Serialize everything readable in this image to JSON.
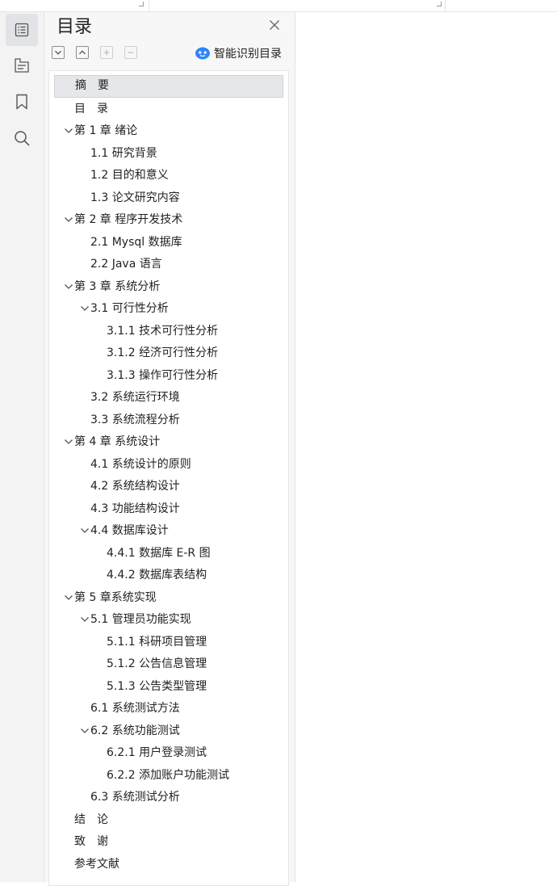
{
  "panel": {
    "title": "目录",
    "smart_label": "智能识别目录"
  },
  "colors": {
    "rail_bg": "#f3f3f3",
    "panel_bg": "#f7f7f7",
    "selected_bg": "#e6e7ea",
    "smart_icon": "#2f86f6"
  },
  "icons": {
    "rail": [
      "toc-icon",
      "outline-icon",
      "bookmark-icon",
      "search-icon"
    ],
    "toolbar": [
      "collapse-all-icon",
      "expand-all-icon",
      "add-icon",
      "remove-icon"
    ]
  },
  "toc": [
    {
      "label": "摘　要",
      "level": 0,
      "expanded": null,
      "selected": true
    },
    {
      "label": "目　录",
      "level": 0,
      "expanded": null
    },
    {
      "label": "第 1 章  绪论",
      "level": 0,
      "expanded": true
    },
    {
      "label": "1.1  研究背景",
      "level": 1,
      "expanded": null
    },
    {
      "label": "1.2 目的和意义",
      "level": 1,
      "expanded": null
    },
    {
      "label": "1.3  论文研究内容",
      "level": 1,
      "expanded": null
    },
    {
      "label": "第 2 章  程序开发技术",
      "level": 0,
      "expanded": true
    },
    {
      "label": "2.1 Mysql 数据库",
      "level": 1,
      "expanded": null
    },
    {
      "label": "2.2 Java 语言",
      "level": 1,
      "expanded": null
    },
    {
      "label": "第 3 章  系统分析",
      "level": 0,
      "expanded": true
    },
    {
      "label": "3.1 可行性分析",
      "level": 1,
      "expanded": true
    },
    {
      "label": "3.1.1 技术可行性分析",
      "level": 2,
      "expanded": null
    },
    {
      "label": "3.1.2 经济可行性分析",
      "level": 2,
      "expanded": null
    },
    {
      "label": "3.1.3 操作可行性分析",
      "level": 2,
      "expanded": null
    },
    {
      "label": "3.2 系统运行环境",
      "level": 1,
      "expanded": null
    },
    {
      "label": "3.3 系统流程分析",
      "level": 1,
      "expanded": null
    },
    {
      "label": "第 4 章  系统设计",
      "level": 0,
      "expanded": true
    },
    {
      "label": "4.1  系统设计的原则",
      "level": 1,
      "expanded": null
    },
    {
      "label": "4.2  系统结构设计",
      "level": 1,
      "expanded": null
    },
    {
      "label": "4.3 功能结构设计",
      "level": 1,
      "expanded": null
    },
    {
      "label": "4.4 数据库设计",
      "level": 1,
      "expanded": true
    },
    {
      "label": "4.4.1  数据库 E-R 图",
      "level": 2,
      "expanded": null
    },
    {
      "label": "4.4.2  数据库表结构",
      "level": 2,
      "expanded": null
    },
    {
      "label": "第 5 章系统实现",
      "level": 0,
      "expanded": true
    },
    {
      "label": "5.1 管理员功能实现",
      "level": 1,
      "expanded": true
    },
    {
      "label": "5.1.1  科研项目管理",
      "level": 2,
      "expanded": null
    },
    {
      "label": "5.1.2  公告信息管理",
      "level": 2,
      "expanded": null
    },
    {
      "label": "5.1.3 公告类型管理",
      "level": 2,
      "expanded": null
    },
    {
      "label": "6.1 系统测试方法",
      "level": 1,
      "expanded": null
    },
    {
      "label": "6.2  系统功能测试",
      "level": 1,
      "expanded": true
    },
    {
      "label": "6.2.1  用户登录测试",
      "level": 2,
      "expanded": null
    },
    {
      "label": "6.2.2  添加账户功能测试",
      "level": 2,
      "expanded": null
    },
    {
      "label": "6.3  系统测试分析",
      "level": 1,
      "expanded": null
    },
    {
      "label": "结　论",
      "level": 0,
      "expanded": null
    },
    {
      "label": "致　谢",
      "level": 0,
      "expanded": null
    },
    {
      "label": "参考文献",
      "level": 0,
      "expanded": null
    }
  ]
}
